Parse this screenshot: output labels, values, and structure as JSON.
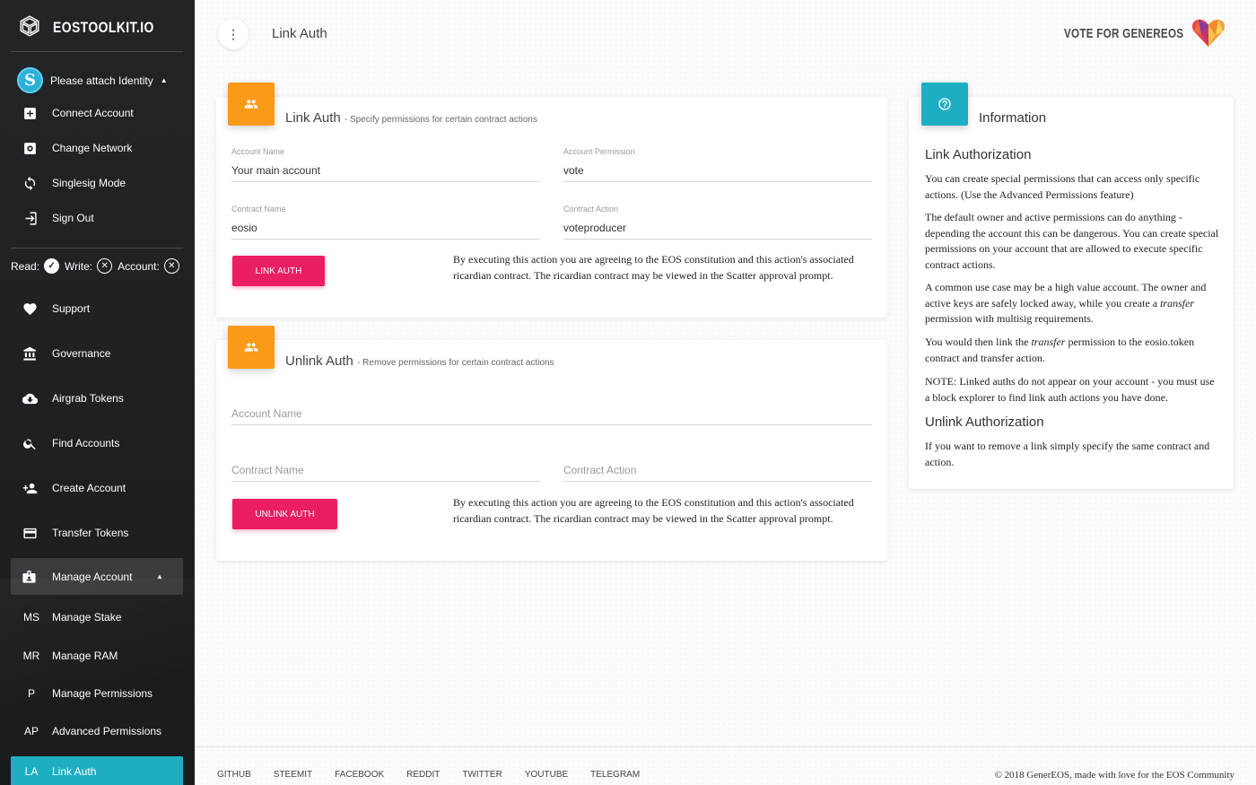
{
  "sidebar": {
    "brand": "EOSTOOLKIT.IO",
    "identity": {
      "avatar_letter": "S",
      "label": "Please attach Identity"
    },
    "account_items": [
      {
        "label": "Connect Account",
        "icon": "plus-box-icon"
      },
      {
        "label": "Change Network",
        "icon": "settings-box-icon"
      },
      {
        "label": "Singlesig Mode",
        "icon": "sync-icon"
      },
      {
        "label": "Sign Out",
        "icon": "sign-out-icon"
      }
    ],
    "status": {
      "read_label": "Read:",
      "write_label": "Write:",
      "account_label": "Account:"
    },
    "nav_items": [
      {
        "label": "Support",
        "icon": "heart-icon"
      },
      {
        "label": "Governance",
        "icon": "bank-icon"
      },
      {
        "label": "Airgrab Tokens",
        "icon": "cloud-download-icon"
      },
      {
        "label": "Find Accounts",
        "icon": "search-icon"
      },
      {
        "label": "Create Account",
        "icon": "person-add-icon"
      },
      {
        "label": "Transfer Tokens",
        "icon": "credit-card-icon"
      }
    ],
    "manage_account": {
      "label": "Manage Account",
      "icon": "badge-icon"
    },
    "sub_items": [
      {
        "abbr": "MS",
        "label": "Manage Stake"
      },
      {
        "abbr": "MR",
        "label": "Manage RAM"
      },
      {
        "abbr": "P",
        "label": "Manage Permissions"
      },
      {
        "abbr": "AP",
        "label": "Advanced Permissions"
      }
    ],
    "active_item": {
      "abbr": "LA",
      "label": "Link Auth"
    }
  },
  "header": {
    "menu_icon": "more-vert-icon",
    "title": "Link Auth",
    "vote_link": "VOTE FOR GENEREOS"
  },
  "link_card": {
    "title": "Link Auth",
    "subtitle": "- Specify permissions for certain contract actions",
    "account_name_label": "Account Name",
    "account_name_value": "Your main account",
    "account_permission_label": "Account Permission",
    "account_permission_value": "vote",
    "contract_name_label": "Contract Name",
    "contract_name_value": "eosio",
    "contract_action_label": "Contract Action",
    "contract_action_value": "voteproducer",
    "button": "Link Auth",
    "disclaimer": "By executing this action you are agreeing to the EOS constitution and this action's associated ricardian contract. The ricardian contract may be viewed in the Scatter approval prompt."
  },
  "unlink_card": {
    "title": "Unlink Auth",
    "subtitle": "- Remove permissions for certain contract actions",
    "account_name_placeholder": "Account Name",
    "contract_name_placeholder": "Contract Name",
    "contract_action_placeholder": "Contract Action",
    "button": "Unlink Auth",
    "disclaimer": "By executing this action you are agreeing to the EOS constitution and this action's associated ricardian contract. The ricardian contract may be viewed in the Scatter approval prompt."
  },
  "info_card": {
    "title": "Information",
    "link_heading": "Link Authorization",
    "p1": "You can create special permissions that can access only specific actions. (Use the Advanced Permissions feature)",
    "p2": "The default owner and active permissions can do anything - depending the account this can be dangerous. You can create special permissions on your account that are allowed to execute specific contract actions.",
    "p3_a": "A common use case may be a high value account. The owner and active keys are safely locked away, while you create a ",
    "p3_em": "transfer",
    "p3_b": " permission with multisig requirements.",
    "p4_a": "You would then link the ",
    "p4_em": "transfer",
    "p4_b": " permission to the eosio.token contract and transfer action.",
    "p5": "NOTE: Linked auths do not appear on your account - you must use a block explorer to find link auth actions you have done.",
    "unlink_heading": "Unlink Authorization",
    "p6": "If you want to remove a link simply specify the same contract and action."
  },
  "footer": {
    "links": [
      "GITHUB",
      "STEEMIT",
      "FACEBOOK",
      "REDDIT",
      "TWITTER",
      "YOUTUBE",
      "TELEGRAM"
    ],
    "copyright": "© 2018 GenerEOS, made with love for the EOS Community"
  },
  "colors": {
    "sidebar_bg": "#232428",
    "accent_teal": "#1eaec4",
    "accent_orange": "#fb9a18",
    "button_pink": "#e91e63"
  }
}
